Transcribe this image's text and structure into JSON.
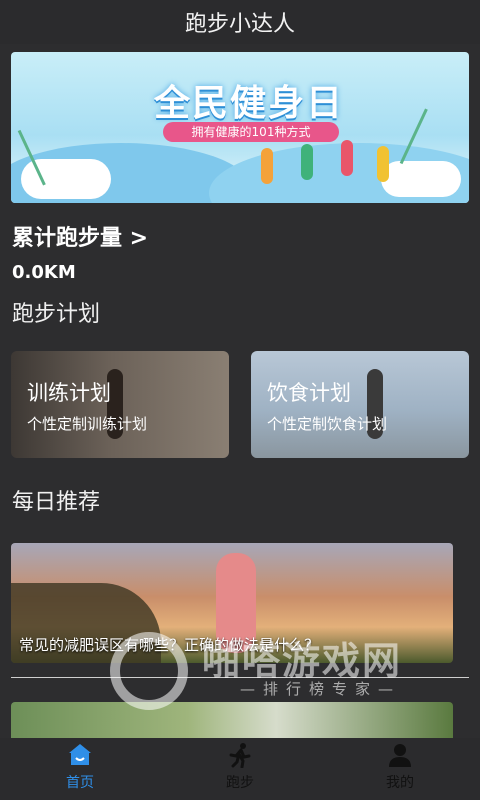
{
  "app": {
    "title": "跑步小达人"
  },
  "banner": {
    "headline": "全民健身日",
    "tagline": "拥有健康的101种方式"
  },
  "summary": {
    "total_label": "累计跑步量 >",
    "total_value": "0.0KM"
  },
  "plans": {
    "section_title": "跑步计划",
    "items": [
      {
        "title": "训练计划",
        "subtitle": "个性定制训练计划"
      },
      {
        "title": "饮食计划",
        "subtitle": "个性定制饮食计划"
      }
    ]
  },
  "recommend": {
    "section_title": "每日推荐",
    "articles": [
      {
        "caption": "常见的减肥误区有哪些？正确的做法是什么？"
      }
    ]
  },
  "watermark": {
    "brand": "啪嗒游戏网",
    "sub": "—排行榜专家—"
  },
  "tabs": [
    {
      "label": "首页",
      "icon": "home-icon",
      "active": true
    },
    {
      "label": "跑步",
      "icon": "runner-icon",
      "active": false
    },
    {
      "label": "我的",
      "icon": "person-icon",
      "active": false
    }
  ],
  "colors": {
    "background": "#2d2d2f",
    "accent": "#2f8fe8",
    "banner_pill": "#e8568a"
  }
}
